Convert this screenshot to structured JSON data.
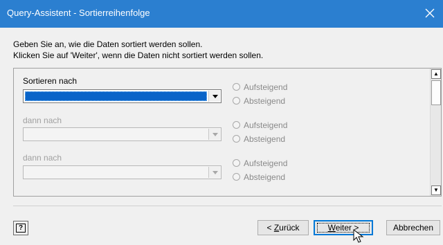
{
  "window": {
    "title": "Query-Assistent - Sortierreihenfolge",
    "close_icon": "close-icon"
  },
  "instructions": {
    "line1": "Geben Sie an, wie die Daten sortiert werden sollen.",
    "line2": "Klicken Sie auf 'Weiter', wenn die Daten nicht sortiert werden sollen."
  },
  "sort_rows": [
    {
      "label": "Sortieren nach",
      "value": "",
      "asc_label": "Aufsteigend",
      "desc_label": "Absteigend",
      "enabled": true
    },
    {
      "label": "dann nach",
      "value": "",
      "asc_label": "Aufsteigend",
      "desc_label": "Absteigend",
      "enabled": false
    },
    {
      "label": "dann nach",
      "value": "",
      "asc_label": "Aufsteigend",
      "desc_label": "Absteigend",
      "enabled": false
    }
  ],
  "buttons": {
    "help_glyph": "?",
    "back_prefix": "< ",
    "back_underline": "Z",
    "back_rest": "urück",
    "next_underline": "W",
    "next_rest": "eiter >",
    "cancel": "Abbrechen"
  },
  "colors": {
    "titlebar": "#2b7fd0",
    "selection": "#0a64c8",
    "focus_border": "#0078d7"
  }
}
